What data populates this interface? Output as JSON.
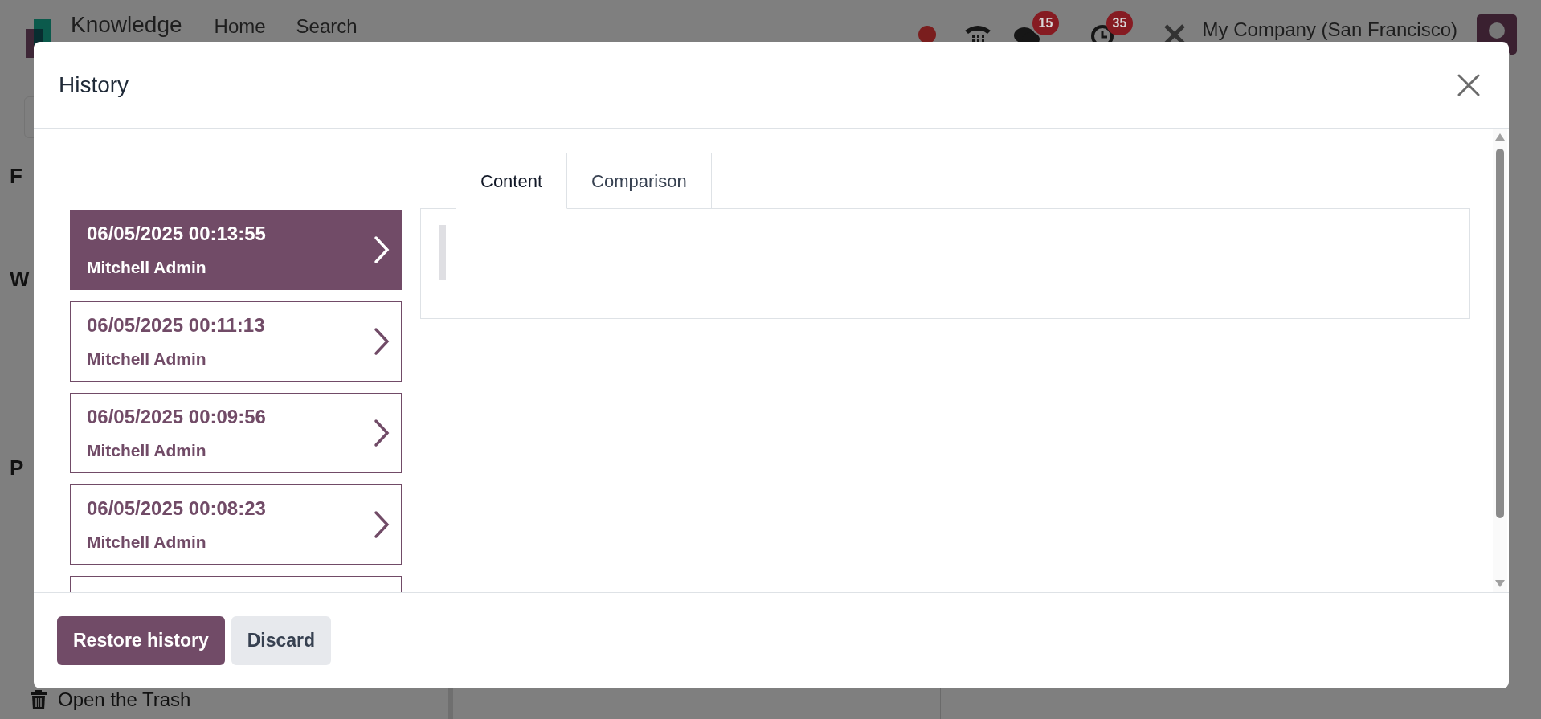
{
  "navbar": {
    "app_name": "Knowledge",
    "menu": [
      "Home",
      "Search"
    ],
    "messages_badge": "15",
    "activities_badge": "35",
    "company": "My Company (San Francisco)"
  },
  "sidebar": {
    "section_headings": [
      "F",
      "W",
      "P"
    ],
    "trash_link": "Open the Trash"
  },
  "dialog": {
    "title": "History",
    "tabs": [
      {
        "label": "Content",
        "selected": true
      },
      {
        "label": "Comparison",
        "selected": false
      }
    ],
    "versions": [
      {
        "date": "06/05/2025 00:13:55",
        "author": "Mitchell Admin",
        "selected": true
      },
      {
        "date": "06/05/2025 00:11:13",
        "author": "Mitchell Admin",
        "selected": false
      },
      {
        "date": "06/05/2025 00:09:56",
        "author": "Mitchell Admin",
        "selected": false
      },
      {
        "date": "06/05/2025 00:08:23",
        "author": "Mitchell Admin",
        "selected": false
      }
    ],
    "buttons": [
      {
        "label": "Restore history",
        "kind": "primary"
      },
      {
        "label": "Discard",
        "kind": "secondary"
      }
    ]
  }
}
